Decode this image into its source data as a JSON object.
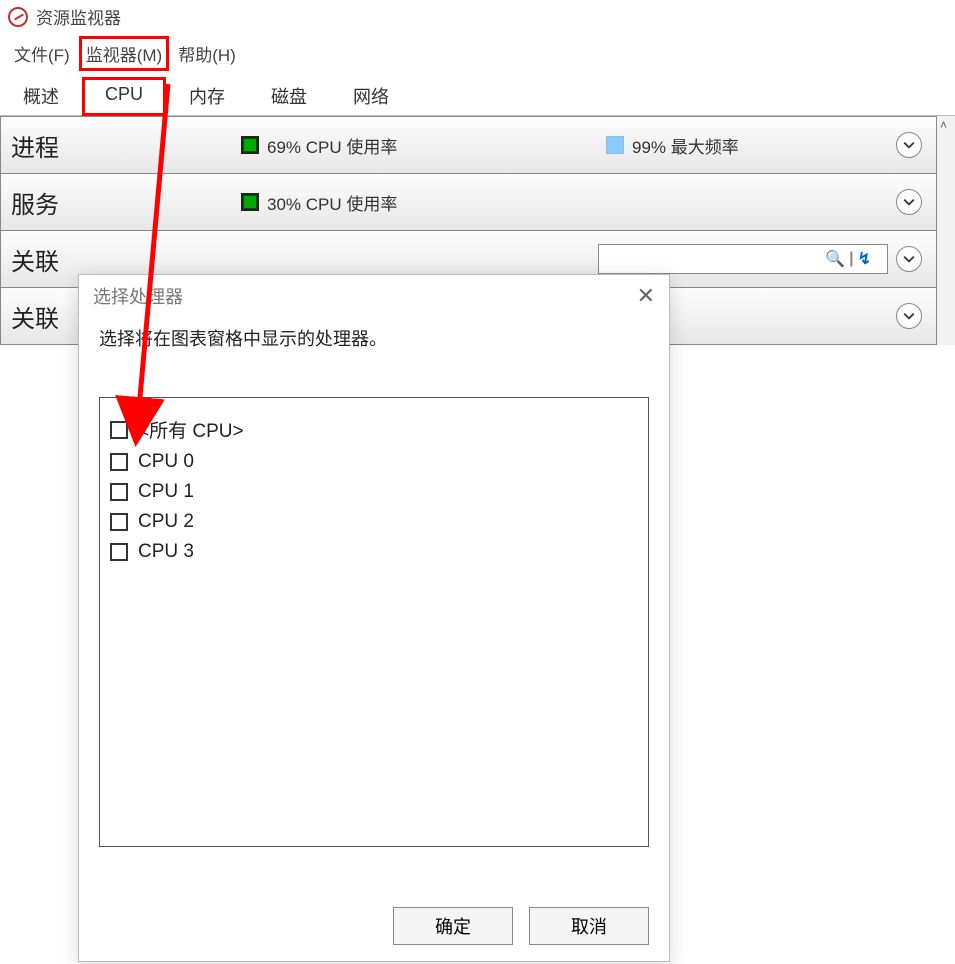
{
  "window": {
    "title": "资源监视器"
  },
  "menubar": {
    "file": "文件(F)",
    "monitor": "监视器(M)",
    "help": "帮助(H)"
  },
  "tabs": {
    "overview": "概述",
    "cpu": "CPU",
    "memory": "内存",
    "disk": "磁盘",
    "network": "网络"
  },
  "sections": {
    "processes": {
      "title": "进程",
      "cpu_stat": "69% CPU 使用率",
      "freq_stat": "99% 最大频率"
    },
    "services": {
      "title": "服务",
      "cpu_stat": "30% CPU 使用率"
    },
    "assoc_handles": {
      "title_partial": "关联"
    },
    "assoc_modules": {
      "title": "关联"
    }
  },
  "dialog": {
    "title": "选择处理器",
    "instruction": "选择将在图表窗格中显示的处理器。",
    "options": [
      "<所有 CPU>",
      "CPU 0",
      "CPU 1",
      "CPU 2",
      "CPU 3"
    ],
    "ok": "确定",
    "cancel": "取消"
  }
}
